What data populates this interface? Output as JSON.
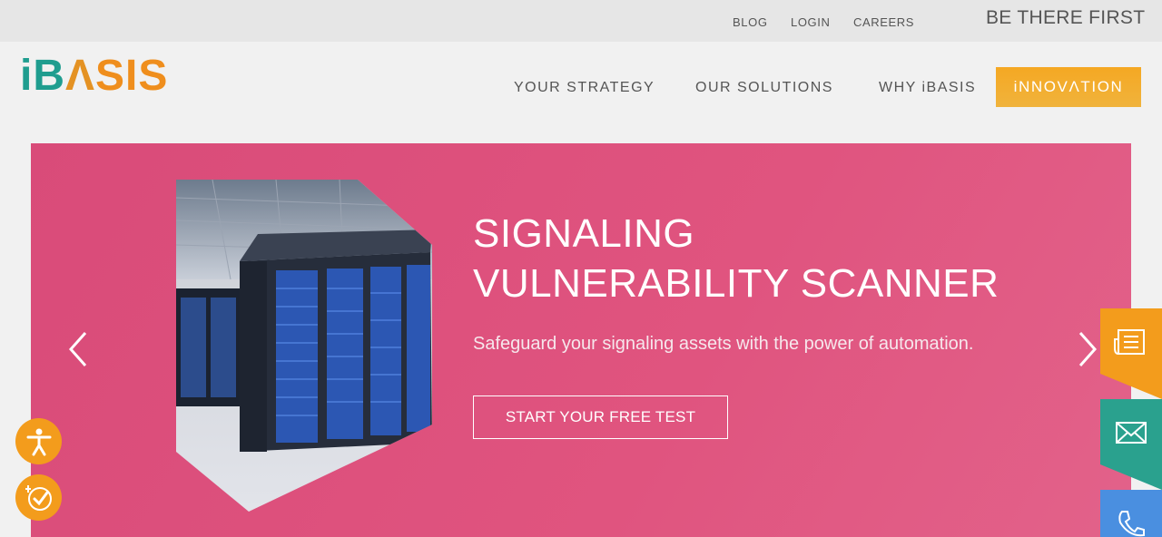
{
  "topbar": {
    "links": [
      "BLOG",
      "LOGIN",
      "CAREERS"
    ],
    "tagline": "BE THERE FIRST"
  },
  "logo": {
    "i": "i",
    "b": "B",
    "a": "Λ",
    "sis": "SIS"
  },
  "nav": {
    "items": [
      "YOUR STRATEGY",
      "OUR SOLUTIONS",
      "WHY iBASIS"
    ],
    "cta": "iNNOVΛTION"
  },
  "hero": {
    "title_line1": "SIGNALING",
    "title_line2": "VULNERABILITY SCANNER",
    "subtitle": "Safeguard your signaling assets with the power of automation.",
    "button": "START YOUR FREE TEST"
  },
  "colors": {
    "teal": "#1f9d8f",
    "orange": "#f39c1c",
    "hero_pink": "#dd5080",
    "tab_orange": "#f39c1c",
    "tab_teal": "#2aa18e",
    "tab_blue": "#4a8fe0"
  },
  "icons": [
    "prev-arrow-icon",
    "next-arrow-icon",
    "document-icon",
    "mail-icon",
    "phone-icon",
    "accessibility-icon",
    "checklist-icon"
  ]
}
